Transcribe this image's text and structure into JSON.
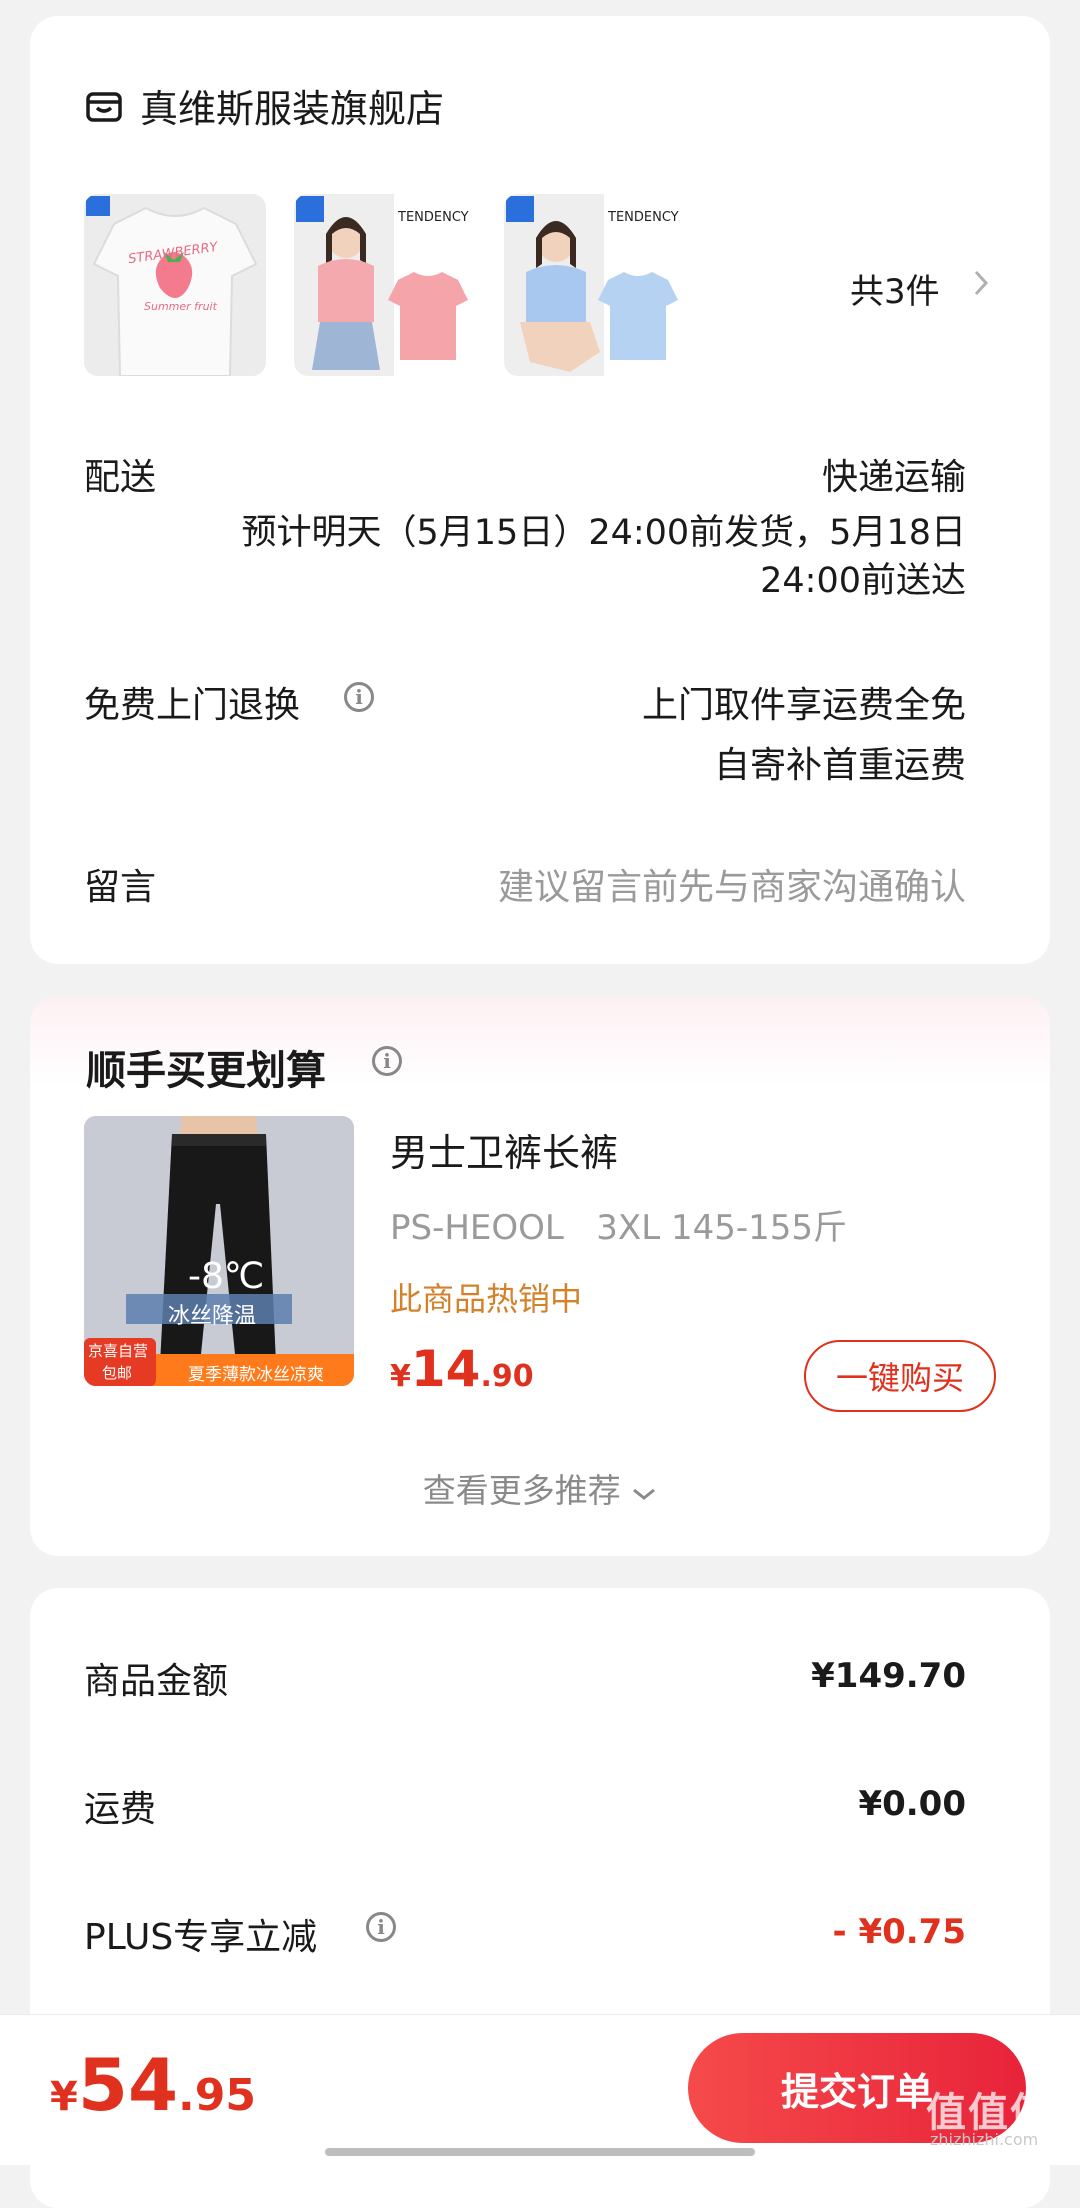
{
  "store": {
    "name": "真维斯服装旗舰店",
    "products": [
      {
        "label": "STRAWBERRY",
        "sub": "Summer fruit"
      },
      {
        "label": "TENDENCY"
      },
      {
        "label": "TENDENCY"
      }
    ],
    "count_label": "共3件",
    "delivery": {
      "label": "配送",
      "method": "快递运输",
      "estimate_line1": "预计明天（5月15日）24:00前发货，5月18日",
      "estimate_line2": "24:00前送达"
    },
    "returns": {
      "label": "免费上门退换",
      "line1": "上门取件享运费全免",
      "line2": "自寄补首重运费"
    },
    "message": {
      "label": "留言",
      "placeholder": "建议留言前先与商家沟通确认"
    }
  },
  "promo": {
    "title": "顺手买更划算",
    "product": {
      "name": "男士卫裤长裤",
      "spec": "PS-HEOOL   3XL 145-155斤",
      "hot_label": "此商品热销中",
      "price_symbol": "¥",
      "price_int": "14",
      "price_dec": ".90",
      "image_temp": "-8℃",
      "image_tag": "冰丝降温",
      "image_badge_top": "京喜自营",
      "image_badge_bottom": "包邮",
      "image_banner": "夏季薄款冰丝凉爽"
    },
    "buy_button": "一键购买",
    "more_label": "查看更多推荐"
  },
  "summary": {
    "rows": [
      {
        "label": "商品金额",
        "value": "¥149.70"
      },
      {
        "label": "运费",
        "value": "¥0.00"
      },
      {
        "label": "PLUS专享立减",
        "value": "- ¥0.75"
      }
    ]
  },
  "bottom": {
    "price_symbol": "¥",
    "price_int": "54",
    "price_dec": ".95",
    "submit_label": "提交订单"
  },
  "watermark": {
    "text": "值值值",
    "sub": "zhizhizhi.com"
  },
  "colors": {
    "accent_red": "#e0301e",
    "hot_orange": "#d4822a"
  }
}
